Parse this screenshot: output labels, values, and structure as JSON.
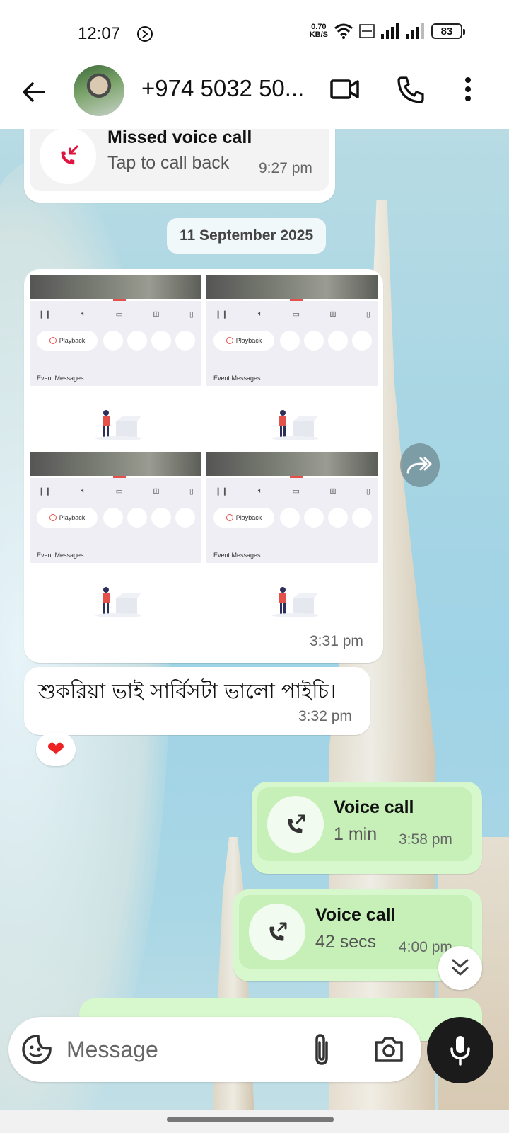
{
  "status_bar": {
    "time": "12:07",
    "net_speed_value": "0.70",
    "net_speed_unit": "KB/S",
    "battery": "83",
    "icons": [
      "dnd-icon",
      "wifi-icon",
      "volte-icon",
      "signal-icon",
      "battery-icon"
    ]
  },
  "header": {
    "contact_name": "+974 5032 50...",
    "icons": [
      "back-arrow-icon",
      "video-call-icon",
      "phone-icon",
      "more-vert-icon"
    ]
  },
  "messages": {
    "missed_call": {
      "title": "Missed voice call",
      "subtitle": "Tap to call back",
      "time": "9:27 pm"
    },
    "date_separator": "11 September 2025",
    "image_grid": {
      "time": "3:31 pm",
      "shots": [
        {
          "playback_label": "Playback",
          "event_label": "Event Messages"
        },
        {
          "playback_label": "Playback",
          "event_label": "Event Messages"
        },
        {
          "playback_label": "Playback",
          "event_label": "Event Messages"
        },
        {
          "playback_label": "Playback",
          "event_label": "Event Messages"
        }
      ]
    },
    "text_message": {
      "text": "শুকরিয়া ভাই সার্বিসটা ভালো পাইচি।",
      "time": "3:32 pm",
      "reaction": "❤"
    },
    "voice_call_1": {
      "title": "Voice call",
      "duration": "1 min",
      "time": "3:58 pm"
    },
    "voice_call_2": {
      "title": "Voice call",
      "duration": "42 secs",
      "time": "4:00 pm"
    }
  },
  "composer": {
    "placeholder": "Message",
    "icons": [
      "sticker-icon",
      "attach-icon",
      "camera-icon",
      "mic-icon"
    ]
  },
  "colors": {
    "outgoing_bubble": "#d7f8cc",
    "incoming_bubble": "#ffffff",
    "missed_call_red": "#e0153f",
    "mic_button": "#1b1b1b"
  }
}
